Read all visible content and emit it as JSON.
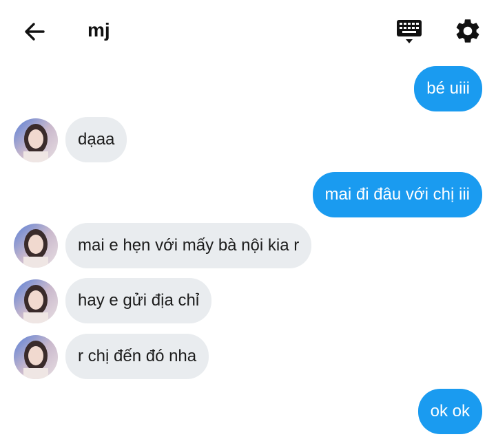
{
  "header": {
    "contact_name": "mj",
    "back_icon": "arrow-left-icon",
    "keyboard_icon": "keyboard-icon",
    "settings_icon": "gear-icon"
  },
  "colors": {
    "outgoing_bubble": "#1a9bf0",
    "incoming_bubble": "#e9ecef"
  },
  "messages": [
    {
      "from": "me",
      "text": "bé uiii"
    },
    {
      "from": "mj",
      "text": "dạaa"
    },
    {
      "from": "me",
      "text": "mai đi đâu với chị iii"
    },
    {
      "from": "mj",
      "text": "mai e hẹn với mấy bà nội kia r"
    },
    {
      "from": "mj",
      "text": "hay e gửi địa chỉ"
    },
    {
      "from": "mj",
      "text": "r chị đến đó nha"
    },
    {
      "from": "me",
      "text": "ok ok"
    }
  ]
}
